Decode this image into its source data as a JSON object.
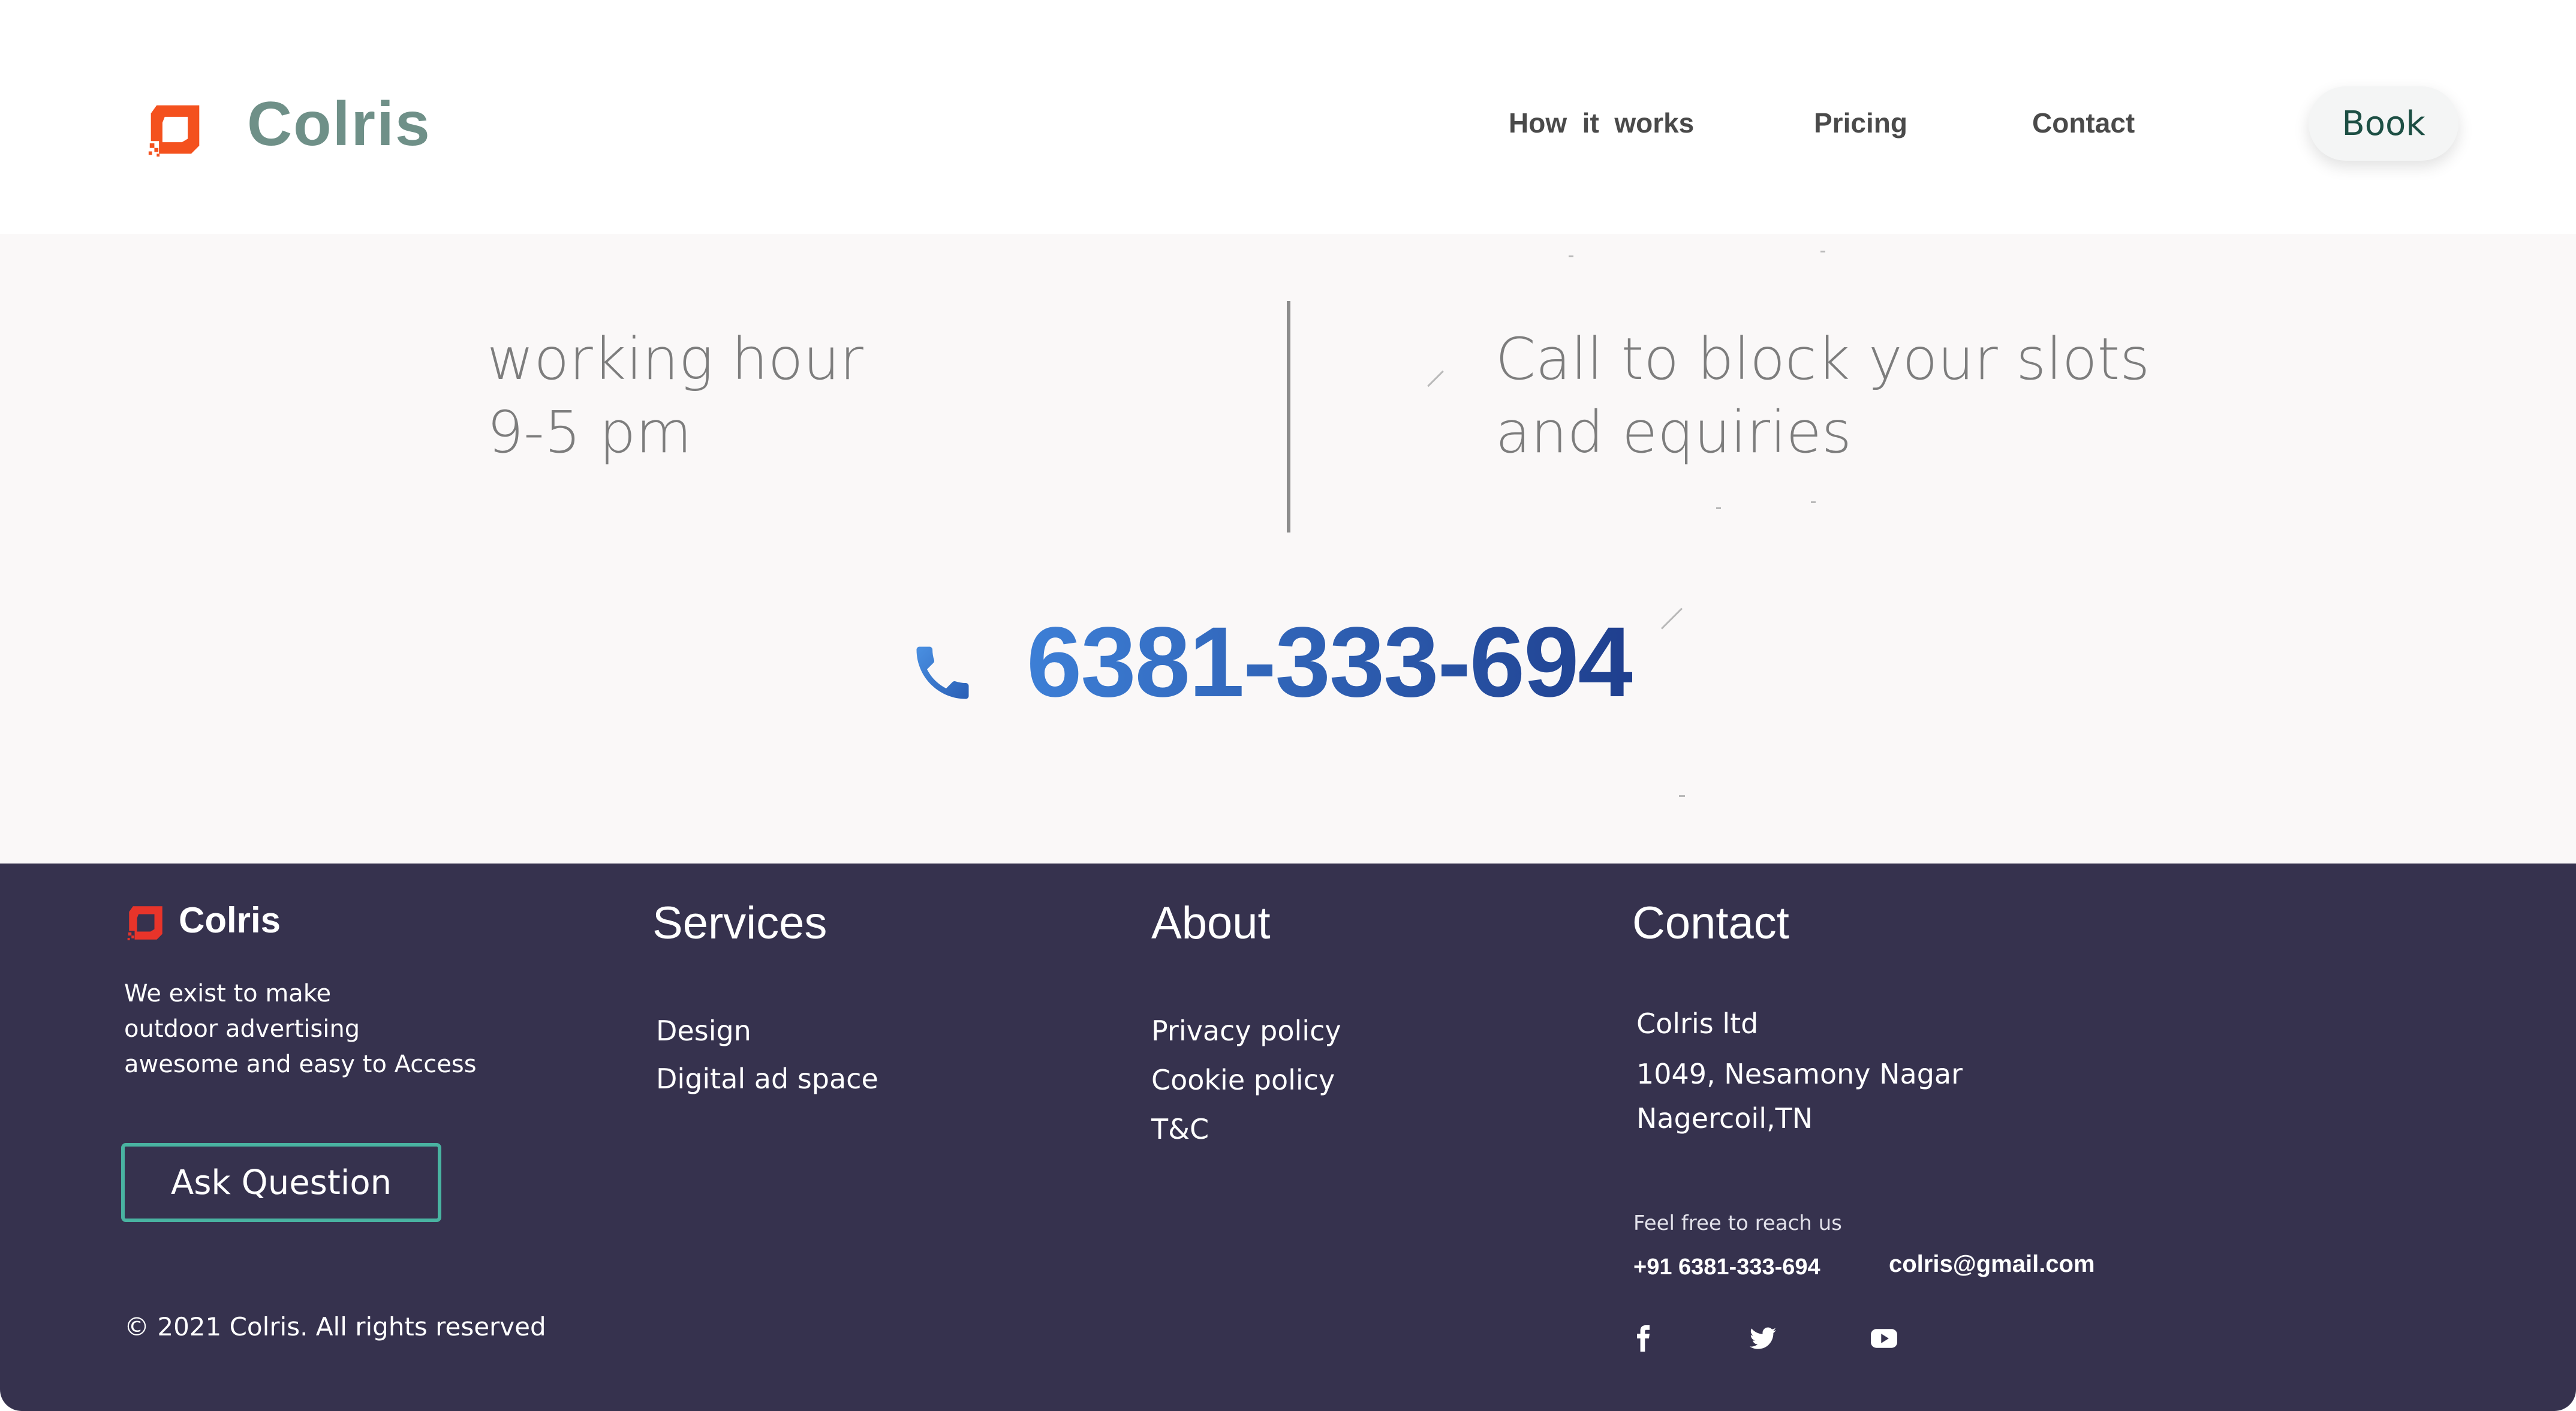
{
  "header": {
    "brand": "Colris",
    "nav": [
      "How  it  works",
      "Pricing",
      "Contact"
    ],
    "book_label": "Book"
  },
  "hours_band": {
    "working_line1": "working hour",
    "working_line2": "9-5 pm",
    "call_line1": "Call to block your slots",
    "call_line2": "and equiries",
    "phone": "6381-333-694"
  },
  "footer": {
    "brand": "Colris",
    "about_lines": [
      "We exist to make",
      "outdoor advertising",
      "awesome and easy to Access"
    ],
    "ask_label": "Ask Question",
    "copyright": "© 2021 Colris. All rights reserved",
    "services": {
      "title": "Services",
      "links": [
        "Design",
        "Digital ad space"
      ]
    },
    "about": {
      "title": "About",
      "links": [
        "Privacy policy",
        "Cookie policy",
        "T&C"
      ]
    },
    "contact": {
      "title": "Contact",
      "address": [
        "Colris ltd",
        "1049, Nesamony Nagar",
        "Nagercoil,TN"
      ],
      "reach_label": "Feel free to reach us",
      "phone": "+91 6381-333-694",
      "email": "colris@gmail.com",
      "social": [
        "facebook-icon",
        "twitter-icon",
        "youtube-icon"
      ]
    }
  },
  "colors": {
    "brand_orange": "#f4511e",
    "brand_text": "#6f9088",
    "footer_bg": "#36324e",
    "accent_teal": "#49b3a1",
    "phone_blue": "#2a4fa0"
  }
}
